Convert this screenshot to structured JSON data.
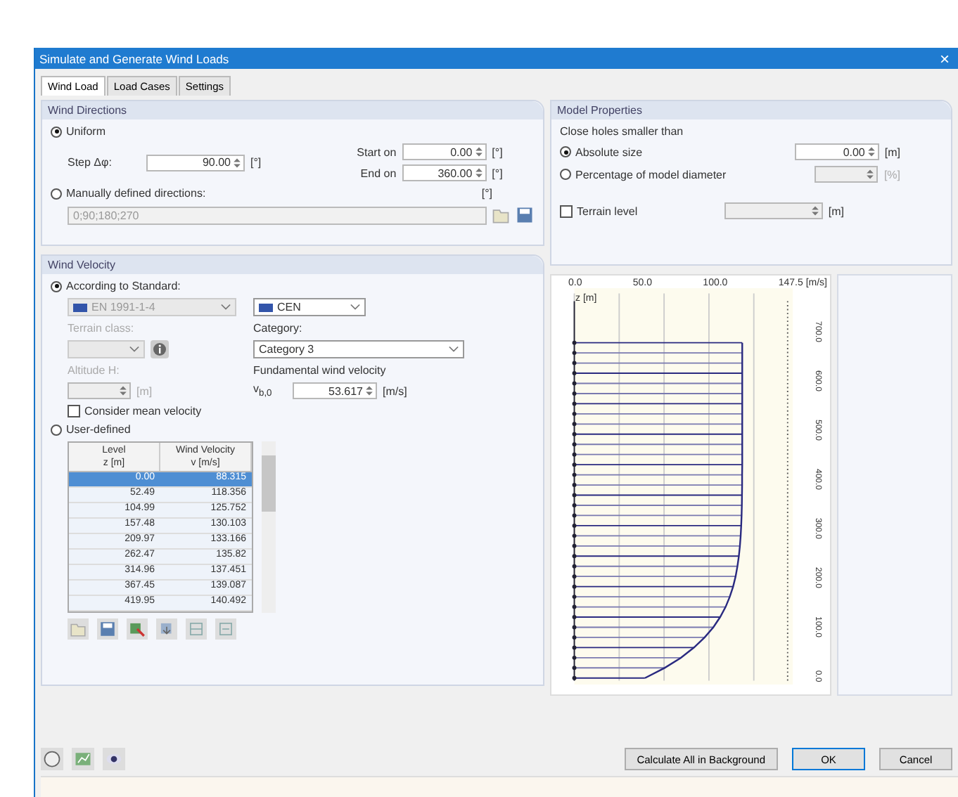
{
  "window": {
    "title": "Simulate and Generate Wind Loads",
    "close": "×"
  },
  "tabs": [
    {
      "label": "Wind Load",
      "selected": true
    },
    {
      "label": "Load Cases",
      "selected": false
    },
    {
      "label": "Settings",
      "selected": false
    }
  ],
  "wind_directions": {
    "title": "Wind Directions",
    "uniform": {
      "label": "Uniform",
      "selected": true
    },
    "step": {
      "label": "Step Δφ:",
      "value": "90.00",
      "unit": "[°]"
    },
    "start": {
      "label": "Start on",
      "value": "0.00",
      "unit": "[°]"
    },
    "end": {
      "label": "End on",
      "value": "360.00",
      "unit": "[°]"
    },
    "manual": {
      "label": "Manually defined directions:",
      "selected": false,
      "unit": "[°]",
      "value": "0;90;180;270"
    }
  },
  "wind_velocity": {
    "title": "Wind Velocity",
    "standard": {
      "label": "According to Standard:",
      "selected": true
    },
    "code": {
      "value": "EN 1991-1-4",
      "disabled": true
    },
    "annex": {
      "value": "CEN",
      "disabled": false
    },
    "terrain_class": {
      "label": "Terrain class:",
      "disabled": true
    },
    "category": {
      "label": "Category:",
      "value": "Category 3"
    },
    "altitude": {
      "label": "Altitude H:",
      "unit": "[m]",
      "disabled": true
    },
    "fundamental": {
      "label": "Fundamental wind velocity",
      "symbol": "v$_{b,0}$",
      "value": "53.617",
      "unit": "[m/s]"
    },
    "consider_mean": {
      "label": "Consider mean velocity",
      "checked": false
    },
    "user_defined": {
      "label": "User-defined",
      "selected": false
    },
    "table": {
      "columns": [
        [
          "Level",
          "z [m]"
        ],
        [
          "Wind Velocity",
          "v [m/s]"
        ]
      ],
      "rows": [
        {
          "level_z": "0.00",
          "velocity": "88.315",
          "selected": true
        },
        {
          "level_z": "52.49",
          "velocity": "118.356",
          "selected": false
        },
        {
          "level_z": "104.99",
          "velocity": "125.752",
          "selected": false
        },
        {
          "level_z": "157.48",
          "velocity": "130.103",
          "selected": false
        },
        {
          "level_z": "209.97",
          "velocity": "133.166",
          "selected": false
        },
        {
          "level_z": "262.47",
          "velocity": "135.82",
          "selected": false
        },
        {
          "level_z": "314.96",
          "velocity": "137.451",
          "selected": false
        },
        {
          "level_z": "367.45",
          "velocity": "139.087",
          "selected": false
        },
        {
          "level_z": "419.95",
          "velocity": "140.492",
          "selected": false
        }
      ]
    }
  },
  "model_properties": {
    "title": "Model Properties",
    "close_holes": "Close holes smaller than",
    "absolute": {
      "label": "Absolute size",
      "selected": true,
      "value": "0.00",
      "unit": "[m]"
    },
    "percentage": {
      "label": "Percentage of model diameter",
      "selected": false,
      "unit": "[%]"
    },
    "terrain_level": {
      "label": "Terrain level",
      "checked": false,
      "unit": "[m]"
    }
  },
  "chart": {
    "x_labels": [
      "0.0",
      "50.0",
      "100.0",
      "147.5 [m/s]"
    ],
    "z_label": "z [m]",
    "z_labels": [
      "700.0",
      "600.0",
      "500.0",
      "400.0",
      "300.0",
      "200.0",
      "100.0",
      "0.0"
    ]
  },
  "buttons": {
    "calculate": "Calculate All in Background",
    "ok": "OK",
    "cancel": "Cancel"
  }
}
